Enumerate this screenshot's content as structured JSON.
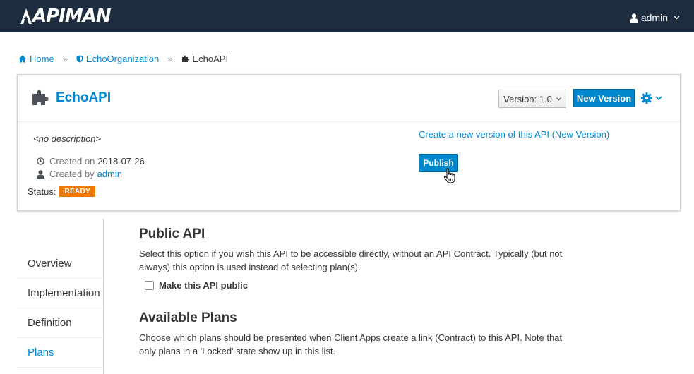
{
  "header": {
    "logo_text": "APIMAN",
    "user_name": "admin"
  },
  "breadcrumb": {
    "home": "Home",
    "organization": "EchoOrganization",
    "api": "EchoAPI",
    "separator": "»"
  },
  "api": {
    "title": "EchoAPI",
    "version_label": "Version: 1.0",
    "new_version_button": "New Version",
    "description": "<no description>",
    "created_on_label": "Created on",
    "created_on_value": "2018-07-26",
    "created_by_label": "Created by",
    "created_by_value": "admin",
    "status_label": "Status:",
    "status_value": "READY",
    "new_version_link": "Create a new version of this API (New Version)",
    "publish_button": "Publish"
  },
  "sidebar": {
    "items": [
      {
        "label": "Overview",
        "active": false
      },
      {
        "label": "Implementation",
        "active": false
      },
      {
        "label": "Definition",
        "active": false
      },
      {
        "label": "Plans",
        "active": true
      }
    ]
  },
  "content": {
    "public_api_title": "Public API",
    "public_api_text": "Select this option if you wish this API to be accessible directly, without an API Contract. Typically (but not always) this option is used instead of selecting plan(s).",
    "make_public_label": "Make this API public",
    "make_public_checked": false,
    "available_plans_title": "Available Plans",
    "available_plans_text": "Choose which plans should be presented when Client Apps create a link (Contract) to this API. Note that only plans in a 'Locked' state show up in this list."
  },
  "colors": {
    "navbar": "#1d2c3e",
    "accent": "#0088ce",
    "status_ready": "#ec7a08"
  }
}
